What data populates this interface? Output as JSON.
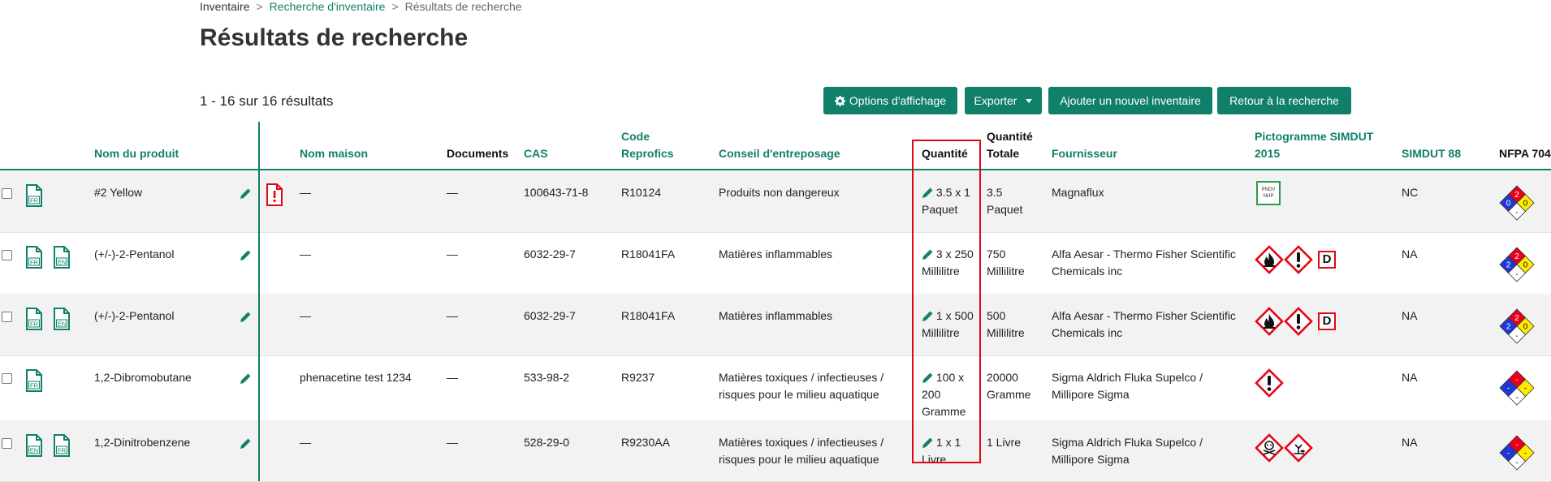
{
  "breadcrumb": {
    "home": "Inventaire",
    "search": "Recherche d'inventaire",
    "current": "Résultats de recherche",
    "separator": ">"
  },
  "page_title": "Résultats de recherche",
  "results_count": "1 - 16 sur 16 résultats",
  "toolbar": {
    "display_options": "Options d'affichage",
    "export": "Exporter",
    "add_inventory": "Ajouter un nouvel inventaire",
    "back_to_search": "Retour à la recherche"
  },
  "colors": {
    "accent": "#10806a",
    "highlight": "#e30613",
    "row_alt": "#f2f2f2"
  },
  "columns": {
    "product_name": "Nom du produit",
    "house_name": "Nom maison",
    "documents": "Documents",
    "cas": "CAS",
    "code": [
      "Code",
      "Reprofics"
    ],
    "storage": "Conseil d'entreposage",
    "quantity": "Quantité",
    "total_quantity": [
      "Quantité",
      "Totale"
    ],
    "supplier": "Fournisseur",
    "pictogram": [
      "Pictogramme SIMDUT",
      "2015"
    ],
    "simdut88": "SIMDUT 88",
    "nfpa": "NFPA 704"
  },
  "rows": [
    {
      "docs": [
        "FR"
      ],
      "name": "#2 Yellow",
      "sds_warning": true,
      "house": "—",
      "documents": "—",
      "cas": "100643-71-8",
      "code": "R10124",
      "storage": [
        "Produits non dangereux"
      ],
      "quantity": [
        "3.5 x 1",
        "Paquet"
      ],
      "total": [
        "3.5",
        "Paquet"
      ],
      "supplier": [
        "Magnaflux"
      ],
      "pictos": [
        "pndv-nhp"
      ],
      "pndv_text": [
        "PNDV",
        "NHP"
      ],
      "simdut88": "NC",
      "nfpa": {
        "top": "2",
        "left": "0",
        "right": "0",
        "bottom": "-"
      }
    },
    {
      "docs": [
        "FR",
        "EN"
      ],
      "name": "(+/-)-2-Pentanol",
      "sds_warning": false,
      "house": "—",
      "documents": "—",
      "cas": "6032-29-7",
      "code": "R18041FA",
      "storage": [
        "Matières inflammables"
      ],
      "quantity": [
        "3 x 250",
        "Millilitre"
      ],
      "total": [
        "750",
        "Millilitre"
      ],
      "supplier": [
        "Alfa Aesar - Thermo Fisher Scientific",
        "Chemicals inc"
      ],
      "pictos": [
        "flame-icon",
        "exclamation-icon",
        "d-class"
      ],
      "d_label": "D",
      "simdut88": "NA",
      "nfpa": {
        "top": "2",
        "left": "2",
        "right": "0",
        "bottom": "-"
      }
    },
    {
      "docs": [
        "FR",
        "EN"
      ],
      "name": "(+/-)-2-Pentanol",
      "sds_warning": false,
      "house": "—",
      "documents": "—",
      "cas": "6032-29-7",
      "code": "R18041FA",
      "storage": [
        "Matières inflammables"
      ],
      "quantity": [
        "1 x 500",
        "Millilitre"
      ],
      "total": [
        "500",
        "Millilitre"
      ],
      "supplier": [
        "Alfa Aesar - Thermo Fisher Scientific",
        "Chemicals inc"
      ],
      "pictos": [
        "flame-icon",
        "exclamation-icon",
        "d-class"
      ],
      "d_label": "D",
      "simdut88": "NA",
      "nfpa": {
        "top": "2",
        "left": "2",
        "right": "0",
        "bottom": "-"
      }
    },
    {
      "docs": [
        "FR"
      ],
      "name": "1,2-Dibromobutane",
      "sds_warning": false,
      "house": "phenacetine test 1234",
      "documents": "—",
      "cas": "533-98-2",
      "code": "R9237",
      "storage": [
        "Matières toxiques / infectieuses /",
        "risques pour le milieu aquatique"
      ],
      "quantity": [
        "100 x",
        "200",
        "Gramme"
      ],
      "total": [
        "20000",
        "Gramme"
      ],
      "supplier": [
        "Sigma Aldrich Fluka Supelco /",
        "Millipore Sigma"
      ],
      "pictos": [
        "exclamation-icon"
      ],
      "simdut88": "NA",
      "nfpa": {
        "top": "-",
        "left": "-",
        "right": "-",
        "bottom": "-"
      }
    },
    {
      "docs": [
        "EN",
        "FR"
      ],
      "name": "1,2-Dinitrobenzene",
      "sds_warning": false,
      "house": "—",
      "documents": "—",
      "cas": "528-29-0",
      "code": "R9230AA",
      "storage": [
        "Matières toxiques / infectieuses /",
        "risques pour le milieu aquatique"
      ],
      "quantity": [
        "1 x 1",
        "Livre"
      ],
      "total": [
        "1 Livre"
      ],
      "supplier": [
        "Sigma Aldrich Fluka Supelco /",
        "Millipore Sigma"
      ],
      "pictos": [
        "skull-icon",
        "environment-icon"
      ],
      "simdut88": "NA",
      "nfpa": {
        "top": "-",
        "left": "-",
        "right": "-",
        "bottom": "-"
      }
    }
  ]
}
